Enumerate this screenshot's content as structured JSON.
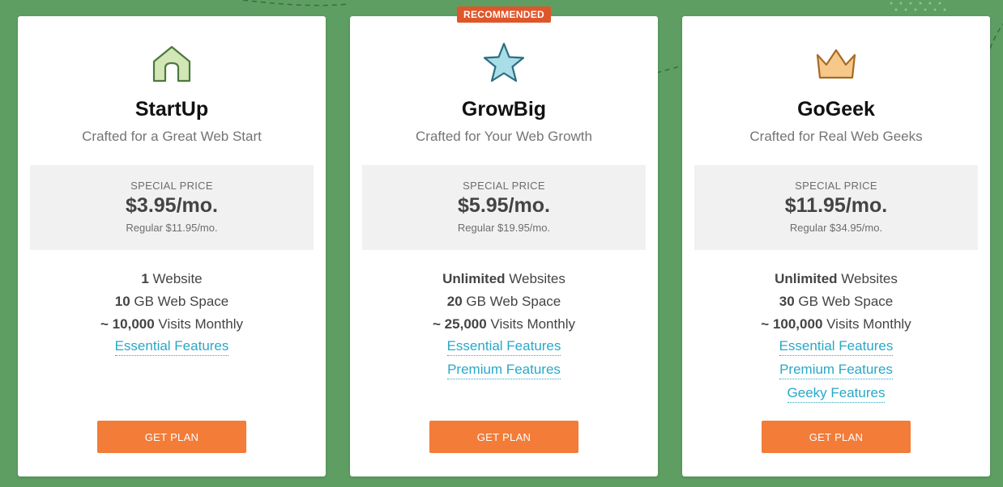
{
  "colors": {
    "background": "#5e9e62",
    "accent_button": "#f27c38",
    "badge": "#e0562b",
    "link": "#29a8c7"
  },
  "plans": [
    {
      "icon": "house-icon",
      "name": "StartUp",
      "tagline": "Crafted for a Great Web Start",
      "special_label": "SPECIAL PRICE",
      "price": "$3.95/mo.",
      "regular": "Regular $11.95/mo.",
      "features": [
        {
          "strong": "1",
          "text": " Website"
        },
        {
          "strong": "10",
          "text": " GB Web Space"
        },
        {
          "strong": "~ 10,000",
          "text": " Visits Monthly"
        }
      ],
      "links": [
        "Essential Features"
      ],
      "button": "GET PLAN"
    },
    {
      "badge": "RECOMMENDED",
      "icon": "star-icon",
      "name": "GrowBig",
      "tagline": "Crafted for Your Web Growth",
      "special_label": "SPECIAL PRICE",
      "price": "$5.95/mo.",
      "regular": "Regular $19.95/mo.",
      "features": [
        {
          "strong": "Unlimited",
          "text": " Websites"
        },
        {
          "strong": "20",
          "text": " GB Web Space"
        },
        {
          "strong": "~ 25,000",
          "text": " Visits Monthly"
        }
      ],
      "links": [
        "Essential Features",
        "Premium Features"
      ],
      "button": "GET PLAN"
    },
    {
      "icon": "crown-icon",
      "name": "GoGeek",
      "tagline": "Crafted for Real Web Geeks",
      "special_label": "SPECIAL PRICE",
      "price": "$11.95/mo.",
      "regular": "Regular $34.95/mo.",
      "features": [
        {
          "strong": "Unlimited",
          "text": " Websites"
        },
        {
          "strong": "30",
          "text": " GB Web Space"
        },
        {
          "strong": "~ 100,000",
          "text": " Visits Monthly"
        }
      ],
      "links": [
        "Essential Features",
        "Premium Features",
        "Geeky Features"
      ],
      "button": "GET PLAN"
    }
  ]
}
